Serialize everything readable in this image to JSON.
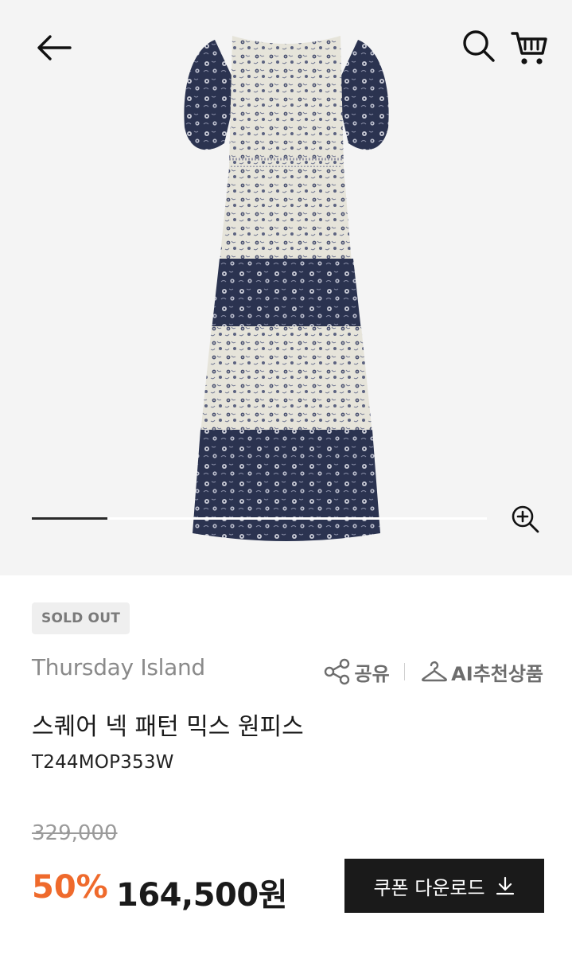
{
  "gallery": {
    "current_index": 1,
    "progress": 0.166
  },
  "product": {
    "status_badge": "SOLD OUT",
    "brand": "Thursday Island",
    "name": "스퀘어 넥 패턴 믹스 원피스",
    "code": "T244MOP353W",
    "original_price": "329,000",
    "discount_rate": "50%",
    "sale_price": "164,500원"
  },
  "actions": {
    "share_label": "공유",
    "ai_recommend_label": "AI추천상품"
  },
  "coupon": {
    "label": "쿠폰 다운로드"
  },
  "colors": {
    "accent": "#ef6a2c",
    "dark": "#1a1a1a",
    "hero_bg": "#f4f4f4",
    "dress_navy": "#2b3350",
    "dress_cream": "#e8e6dc"
  },
  "icons": {
    "back": "arrow-left-icon",
    "search": "search-icon",
    "cart": "cart-icon",
    "zoom": "zoom-in-icon",
    "share": "share-icon",
    "hanger": "hanger-icon",
    "download": "download-icon"
  }
}
